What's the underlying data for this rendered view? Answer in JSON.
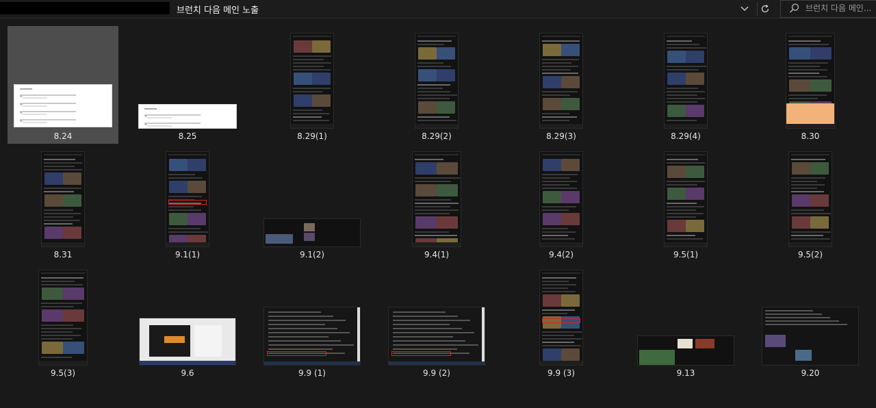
{
  "window": {
    "folder_title": "브런치 다음 메인 노출",
    "search_placeholder": "브런치 다음 메인..."
  },
  "icons": {
    "chevron": "chevron-down-icon",
    "refresh": "refresh-icon",
    "search": "search-icon"
  },
  "thumbnails": [
    {
      "label": "8.24",
      "kind": "white",
      "selected": true
    },
    {
      "label": "8.25",
      "kind": "white",
      "selected": false
    },
    {
      "label": "8.29(1)",
      "kind": "phone",
      "selected": false
    },
    {
      "label": "8.29(2)",
      "kind": "phone",
      "selected": false
    },
    {
      "label": "8.29(3)",
      "kind": "phone",
      "selected": false
    },
    {
      "label": "8.29(4)",
      "kind": "phone",
      "selected": false
    },
    {
      "label": "8.30",
      "kind": "phone",
      "selected": false
    },
    {
      "label": "8.31",
      "kind": "phone",
      "selected": false
    },
    {
      "label": "9.1(1)",
      "kind": "phone",
      "selected": false
    },
    {
      "label": "9.1(2)",
      "kind": "wide",
      "selected": false
    },
    {
      "label": "9.4(1)",
      "kind": "phone",
      "selected": false
    },
    {
      "label": "9.4(2)",
      "kind": "phone",
      "selected": false
    },
    {
      "label": "9.5(1)",
      "kind": "phone",
      "selected": false
    },
    {
      "label": "9.5(2)",
      "kind": "phone",
      "selected": false
    },
    {
      "label": "9.5(3)",
      "kind": "phone",
      "selected": false
    },
    {
      "label": "9.6",
      "kind": "wide",
      "selected": false
    },
    {
      "label": "9.9 (1)",
      "kind": "wide",
      "selected": false
    },
    {
      "label": "9.9 (2)",
      "kind": "wide",
      "selected": false
    },
    {
      "label": "9.9 (3)",
      "kind": "phone",
      "selected": false
    },
    {
      "label": "9.13",
      "kind": "wide",
      "selected": false
    },
    {
      "label": "9.20",
      "kind": "wide",
      "selected": false
    }
  ]
}
